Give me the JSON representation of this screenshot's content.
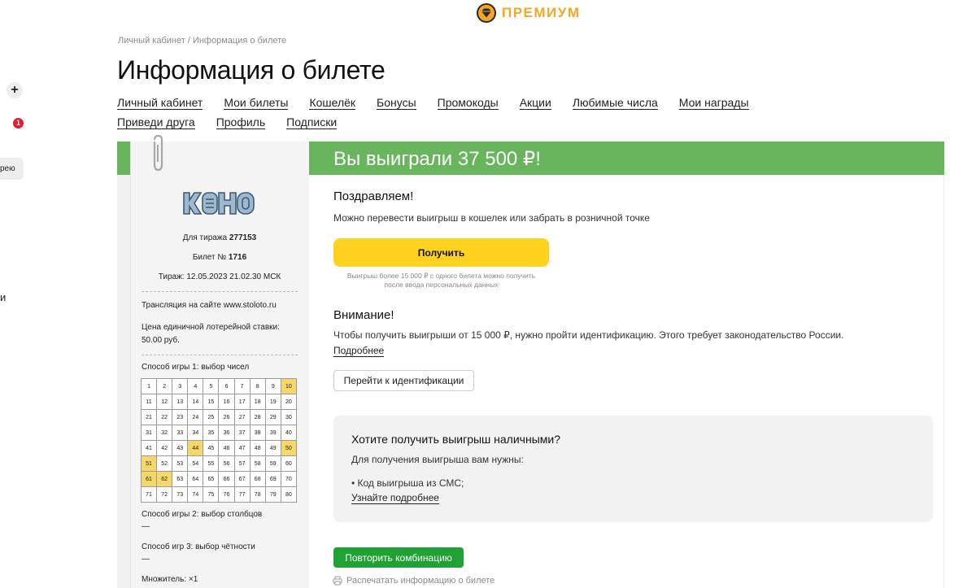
{
  "premium": {
    "label": "ПРЕМИУМ",
    "icon": "diamond-icon",
    "accent": "#f5a623"
  },
  "left_edge": {
    "plus": "+",
    "badge_count": "1",
    "pill_text": "рею",
    "cut_text": "и"
  },
  "breadcrumb": "Личный кабинет / Информация о билете",
  "page_title": "Информация о билете",
  "nav": {
    "row1": [
      "Личный кабинет",
      "Мои билеты",
      "Кошелёк",
      "Бонусы",
      "Промокоды",
      "Акции",
      "Любимые числа",
      "Мои награды"
    ],
    "row2": [
      "Приведи друга",
      "Профиль",
      "Подписки"
    ]
  },
  "win_banner": {
    "text": "Вы выиграли 37 500 ₽!",
    "color": "#68b55e"
  },
  "ticket": {
    "logo": "КЕНО",
    "draw_label": "Для тиража",
    "draw_number": "277153",
    "ticket_label": "Билет №",
    "ticket_number": "1716",
    "draw_datetime": "Тираж: 12.05.2023 21.02.30 МСК",
    "broadcast": "Трансляция на сайте www.stoloto.ru",
    "price_line1": "Цена единичной лотерейной ставки:",
    "price_line2": "50.00 руб.",
    "game1_title": "Способ игры 1: выбор чисел",
    "selected_numbers": [
      10,
      44,
      50,
      51,
      61,
      62
    ],
    "game2_title": "Способ игры 2: выбор столбцов",
    "game2_value": "—",
    "game3_title": "Способ игр 3: выбор чётности",
    "game3_value": "—",
    "multiplier": "Множитель: ×1",
    "highlight_color": "#f5d76a"
  },
  "panel": {
    "congrats_title": "Поздравляем!",
    "congrats_text": "Можно перевести выигрыш в кошелек или забрать в розничной точке",
    "get_button": "Получить",
    "get_note_line1": "Выигрыш более 15 000 ₽ с одного билета можно получить",
    "get_note_line2": "после ввода персональных данных",
    "attention_title": "Внимание!",
    "attention_text": "Чтобы получить выигрыши от 15 000 ₽, нужно пройти идентификацию. Этого требует законодательство России.",
    "more_link": "Подробнее",
    "ident_button": "Перейти к идентификации",
    "cash": {
      "title": "Хотите получить выигрыш наличными?",
      "subtitle": "Для получения выигрыша вам нужны:",
      "item": "• Код выигрыша из СМС;",
      "link": "Узнайте подробнее"
    },
    "repeat_button": "Повторить комбинацию",
    "print_link": "Распечатать информацию о билете",
    "print_icon": "printer-icon"
  }
}
